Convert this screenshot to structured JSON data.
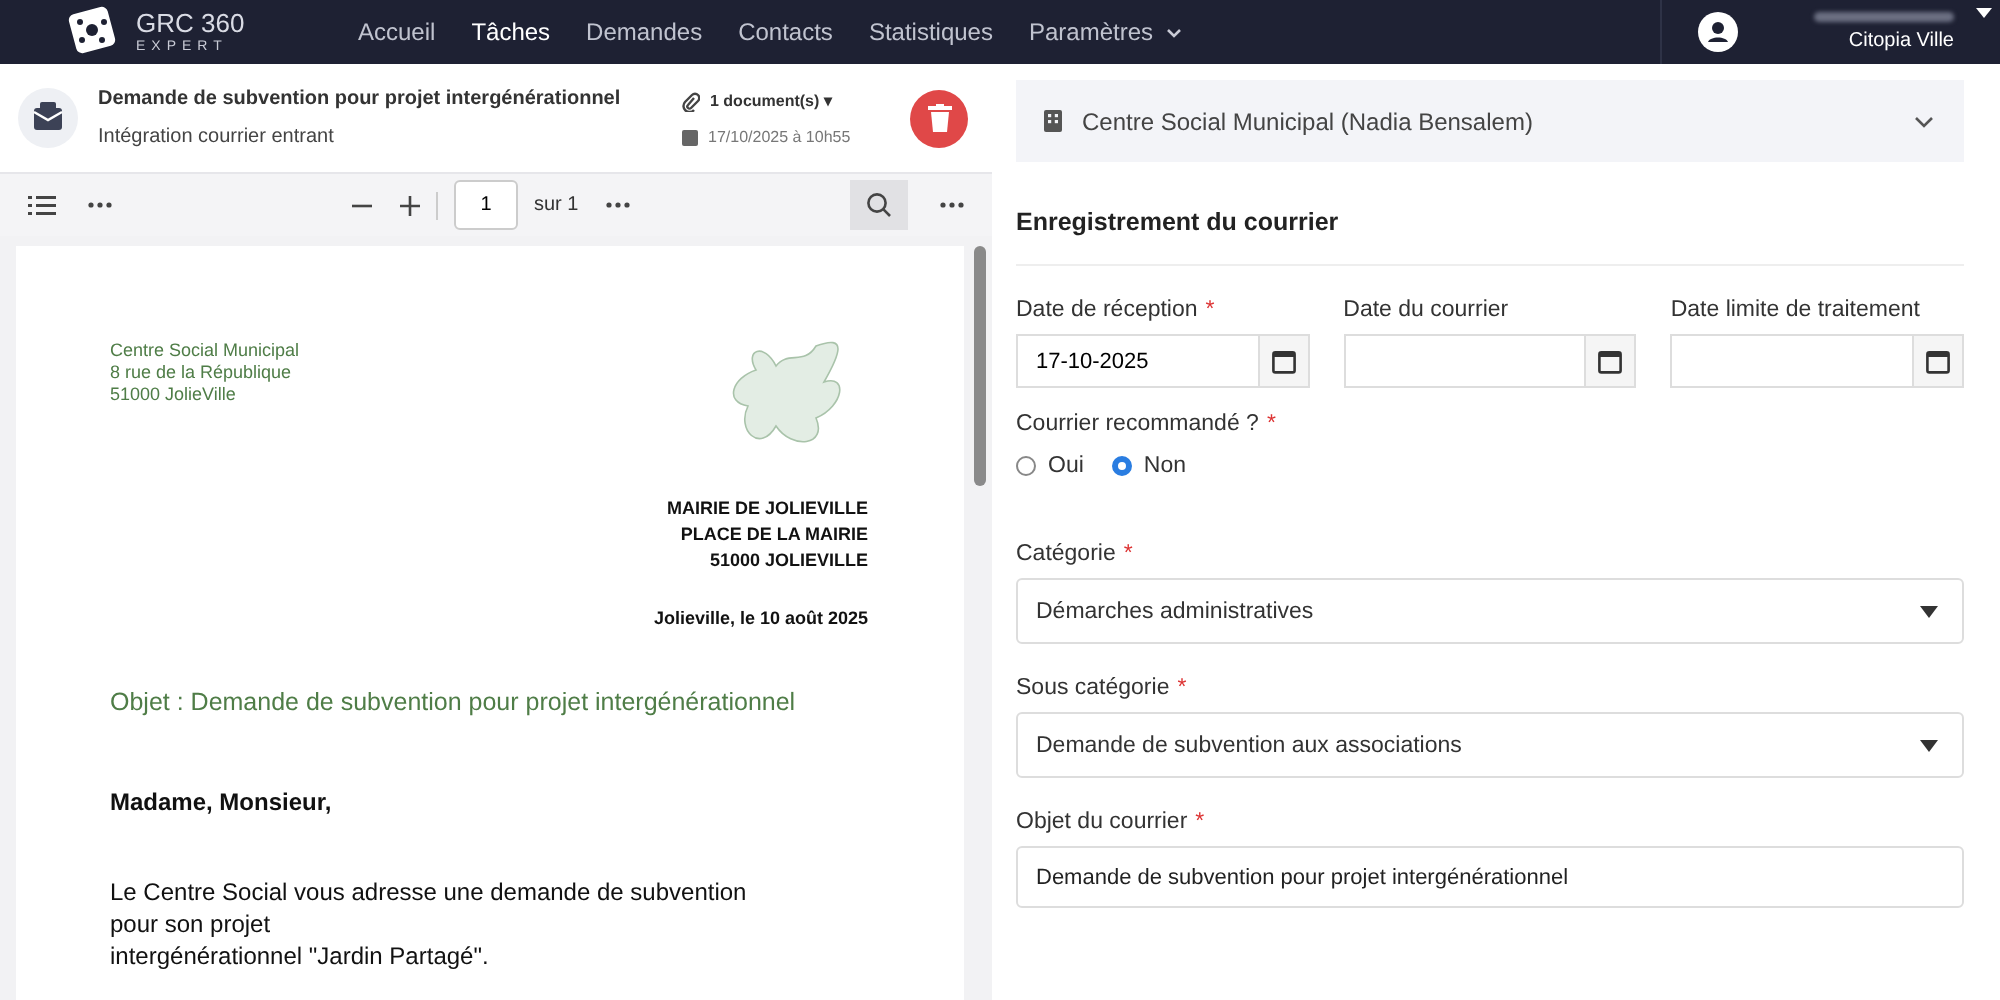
{
  "brand": {
    "name": "GRC 360",
    "tagline": "EXPERT"
  },
  "nav": [
    {
      "label": "Accueil",
      "selected": false,
      "dropdown": false
    },
    {
      "label": "Tâches",
      "selected": true,
      "dropdown": false
    },
    {
      "label": "Demandes",
      "selected": false,
      "dropdown": false
    },
    {
      "label": "Contacts",
      "selected": false,
      "dropdown": false
    },
    {
      "label": "Statistiques",
      "selected": false,
      "dropdown": false
    },
    {
      "label": "Paramètres",
      "selected": false,
      "dropdown": true
    }
  ],
  "user": {
    "organization": "Citopia Ville"
  },
  "task": {
    "title": "Demande de subvention pour projet intergénérationnel",
    "subtitle": "Intégration courrier entrant",
    "documents": "1 document(s) ▾",
    "date": "17/10/2025 à 10h55"
  },
  "viewer": {
    "page": "1",
    "page_total": "sur 1"
  },
  "letter": {
    "sender": [
      "Centre Social Municipal",
      "8 rue de la République",
      "51000 JolieVille"
    ],
    "recipient": [
      "MAIRIE DE JOLIEVILLE",
      "PLACE DE LA MAIRIE",
      "51000 JOLIEVILLE"
    ],
    "date_line": "Jolieville, le 10 août 2025",
    "subject": "Objet : Demande de subvention pour projet intergénérationnel",
    "salutation": "Madame, Monsieur,",
    "body": [
      "Le Centre Social vous adresse une demande de subvention",
      "pour son projet",
      "intergénérationnel \"Jardin Partagé\"."
    ]
  },
  "contact_panel": {
    "label": "Centre Social Municipal (Nadia Bensalem)"
  },
  "form": {
    "title": "Enregistrement du courrier",
    "dates": [
      {
        "label": "Date de réception",
        "required_mark": "*",
        "value": "17-10-2025"
      },
      {
        "label": "Date du courrier"
      },
      {
        "label": "Date limite de traitement"
      }
    ],
    "registered": {
      "label": "Courrier recommandé ?",
      "required_mark": "*",
      "options": [
        {
          "label": "Oui",
          "selected": false
        },
        {
          "label": "Non",
          "selected": true
        }
      ]
    },
    "category": {
      "label": "Catégorie",
      "required_mark": "*",
      "value": "Démarches administratives"
    },
    "subcategory": {
      "label": "Sous catégorie",
      "required_mark": "*",
      "value": "Demande de subvention aux associations"
    },
    "subject": {
      "label": "Objet du courrier",
      "required_mark": "*",
      "value": "Demande de subvention pour projet intergénérationnel"
    }
  }
}
